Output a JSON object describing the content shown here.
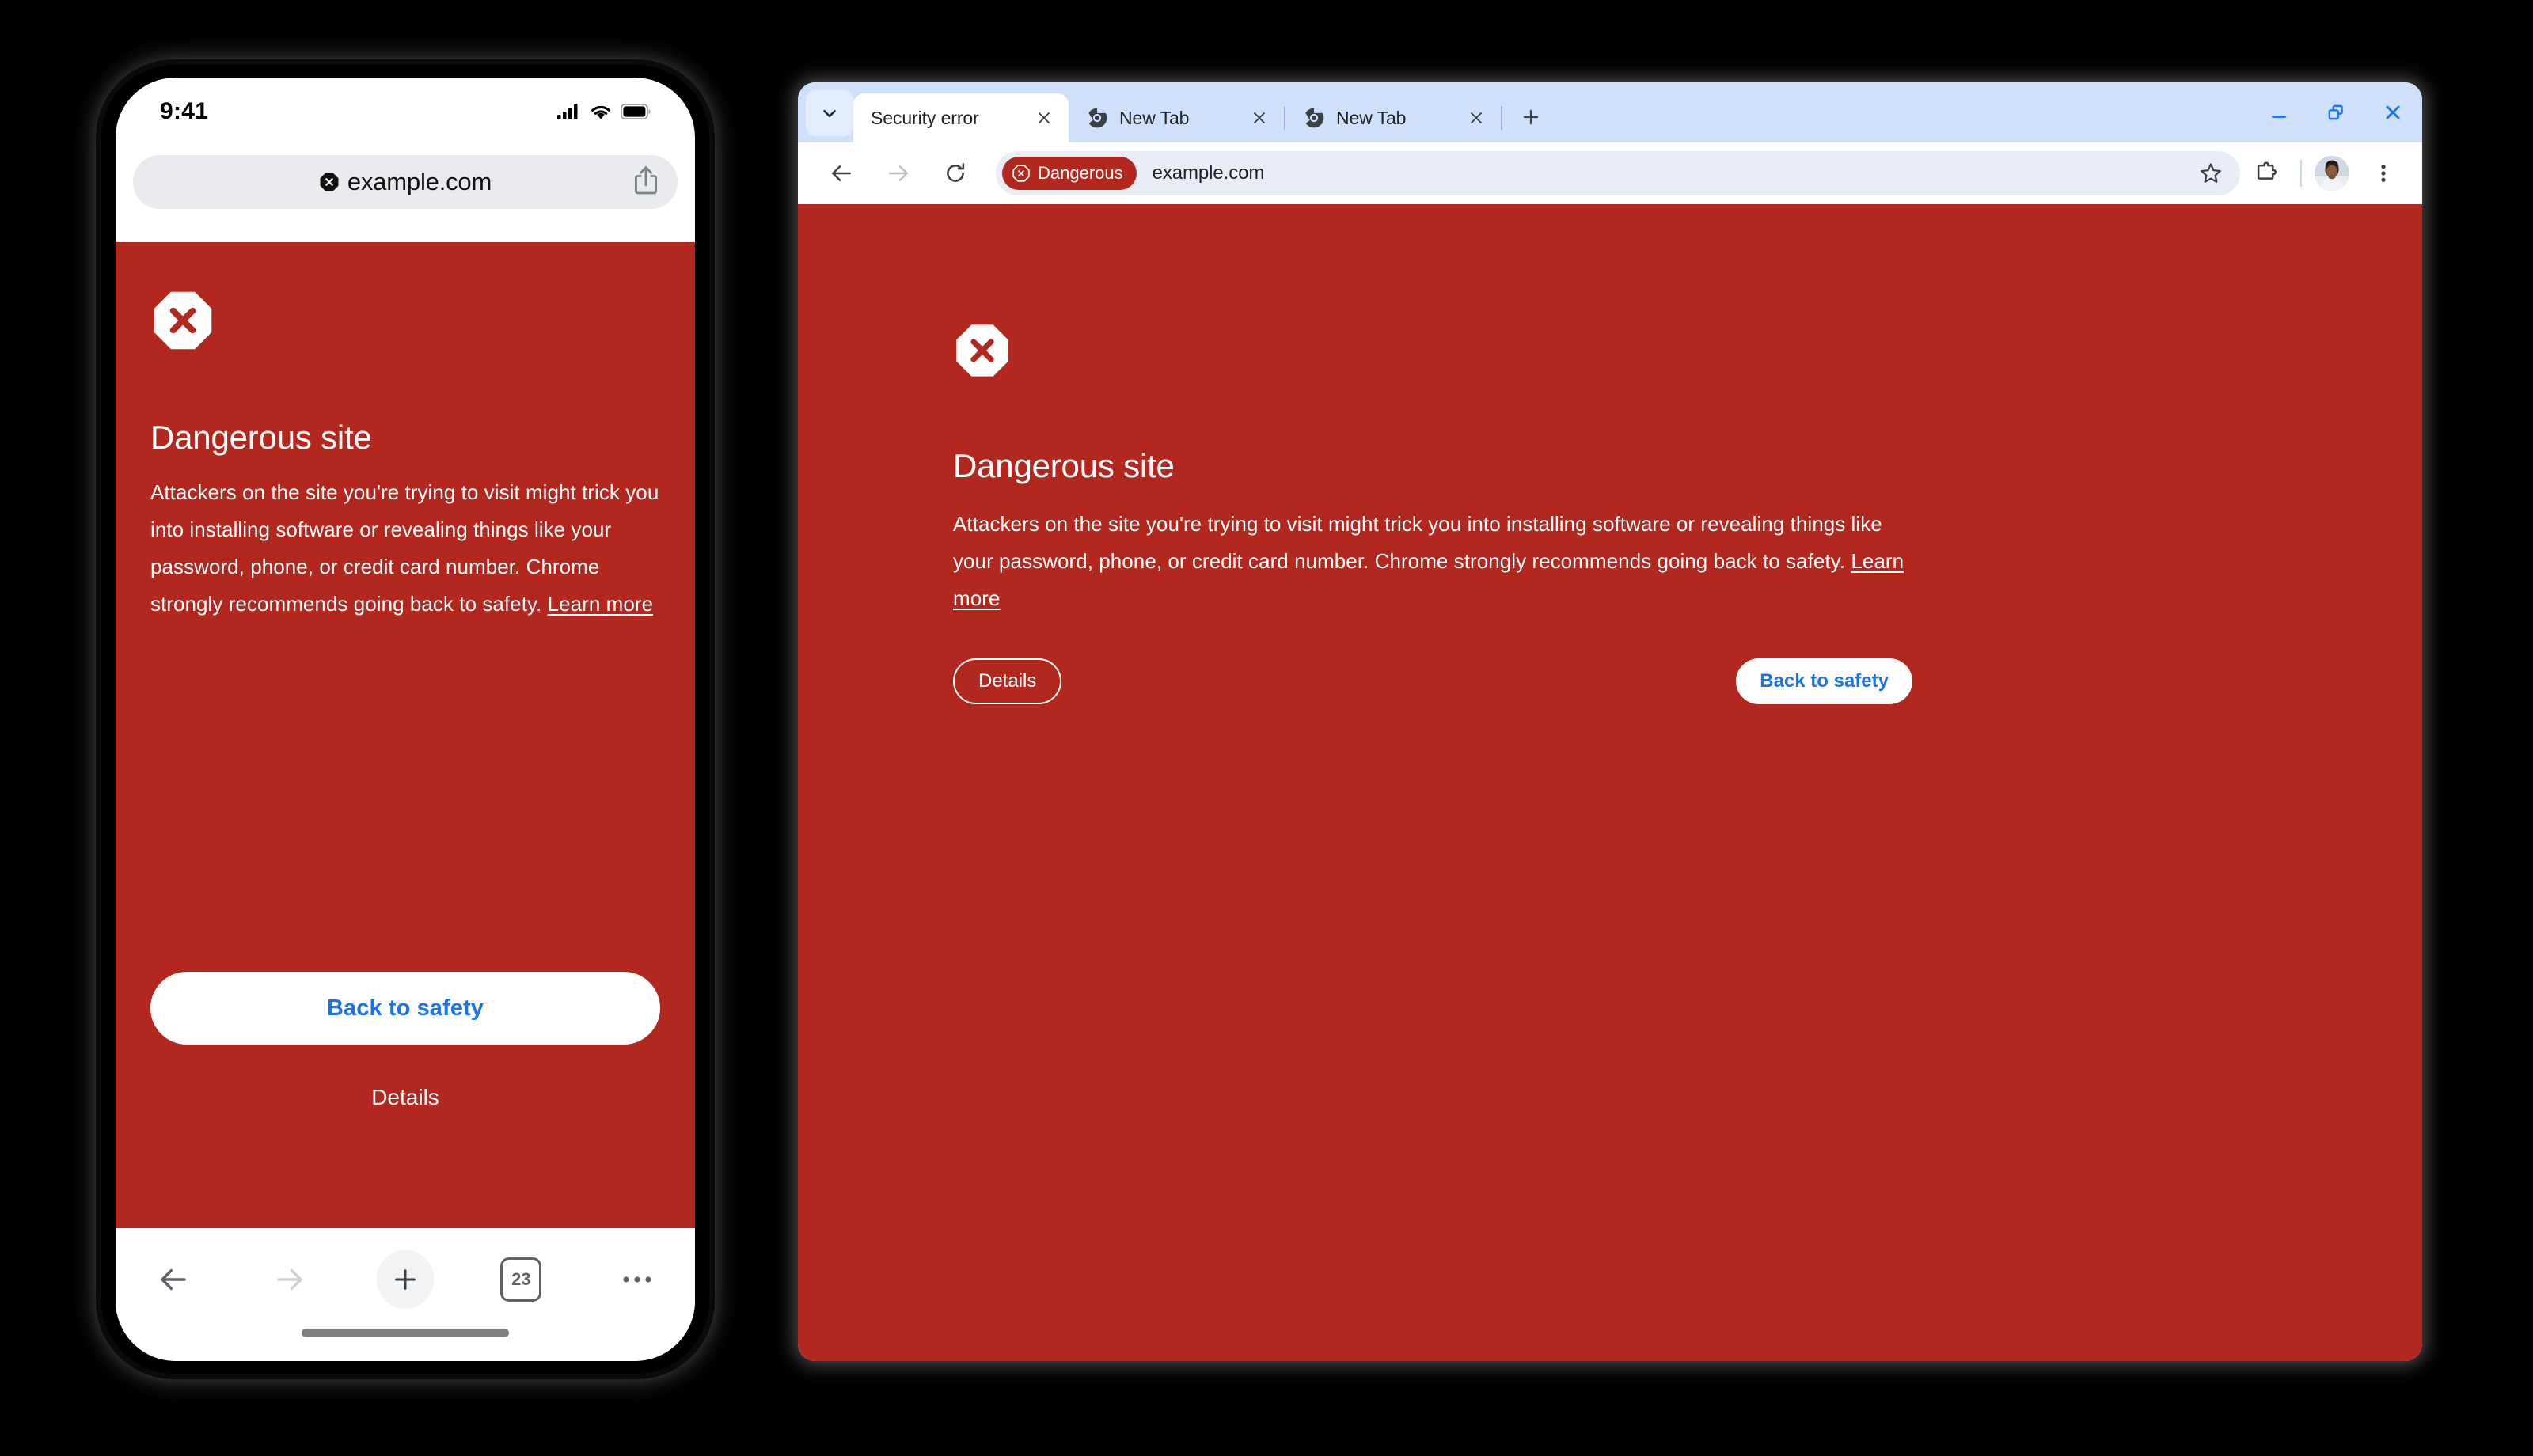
{
  "colors": {
    "danger_red": "#b3281e",
    "tabstrip_blue": "#cfe0fb",
    "link_blue": "#1a73e8",
    "omnibox_bg": "#e9eef6",
    "mobile_urlbar_bg": "#e8eaed"
  },
  "mobile": {
    "status": {
      "time": "9:41",
      "signal_icon": "cellular-signal-icon",
      "wifi_icon": "wifi-icon",
      "battery_icon": "battery-full-icon"
    },
    "urlbar": {
      "security_icon": "dangerous-octagon-icon",
      "url": "example.com",
      "share_icon": "share-icon"
    },
    "interstitial": {
      "icon": "dangerous-octagon-icon",
      "title": "Dangerous site",
      "body_before_link": "Attackers on the site you're trying to visit might trick you into installing software or revealing things like your password, phone, or credit card number. Chrome strongly recommends going back to safety. ",
      "learn_more": "Learn more",
      "primary_button": "Back to safety",
      "secondary_button": "Details"
    },
    "bottombar": {
      "back_icon": "arrow-back-icon",
      "forward_icon": "arrow-forward-icon",
      "new_tab_icon": "plus-icon",
      "tab_count": "23",
      "menu_icon": "more-horizontal-icon"
    }
  },
  "desktop": {
    "tabstrip": {
      "tab_search_icon": "chevron-down-icon",
      "new_tab_icon": "plus-icon",
      "tabs": [
        {
          "title": "Security error",
          "favicon": "none",
          "active": true,
          "close_icon": "close-icon"
        },
        {
          "title": "New Tab",
          "favicon": "chrome-logo-icon",
          "active": false,
          "close_icon": "close-icon"
        },
        {
          "title": "New Tab",
          "favicon": "chrome-logo-icon",
          "active": false,
          "close_icon": "close-icon"
        }
      ],
      "window_controls": {
        "minimize_icon": "minimize-icon",
        "restore_icon": "restore-window-icon",
        "close_icon": "close-window-icon"
      }
    },
    "toolbar": {
      "back_icon": "arrow-back-icon",
      "forward_icon": "arrow-forward-icon",
      "reload_icon": "reload-icon",
      "danger_chip_icon": "dangerous-octagon-icon",
      "danger_chip_label": "Dangerous",
      "url": "example.com",
      "bookmark_icon": "star-icon",
      "extensions_icon": "puzzle-piece-icon",
      "profile_icon": "avatar",
      "menu_icon": "more-vertical-icon"
    },
    "interstitial": {
      "icon": "dangerous-octagon-icon",
      "title": "Dangerous site",
      "body_before_link": "Attackers on the site you're trying to visit might trick you into installing software or revealing things like your password, phone, or credit card number. Chrome strongly recommends going back to safety. ",
      "learn_more": "Learn more",
      "details_button": "Details",
      "back_to_safety_button": "Back to safety"
    }
  }
}
